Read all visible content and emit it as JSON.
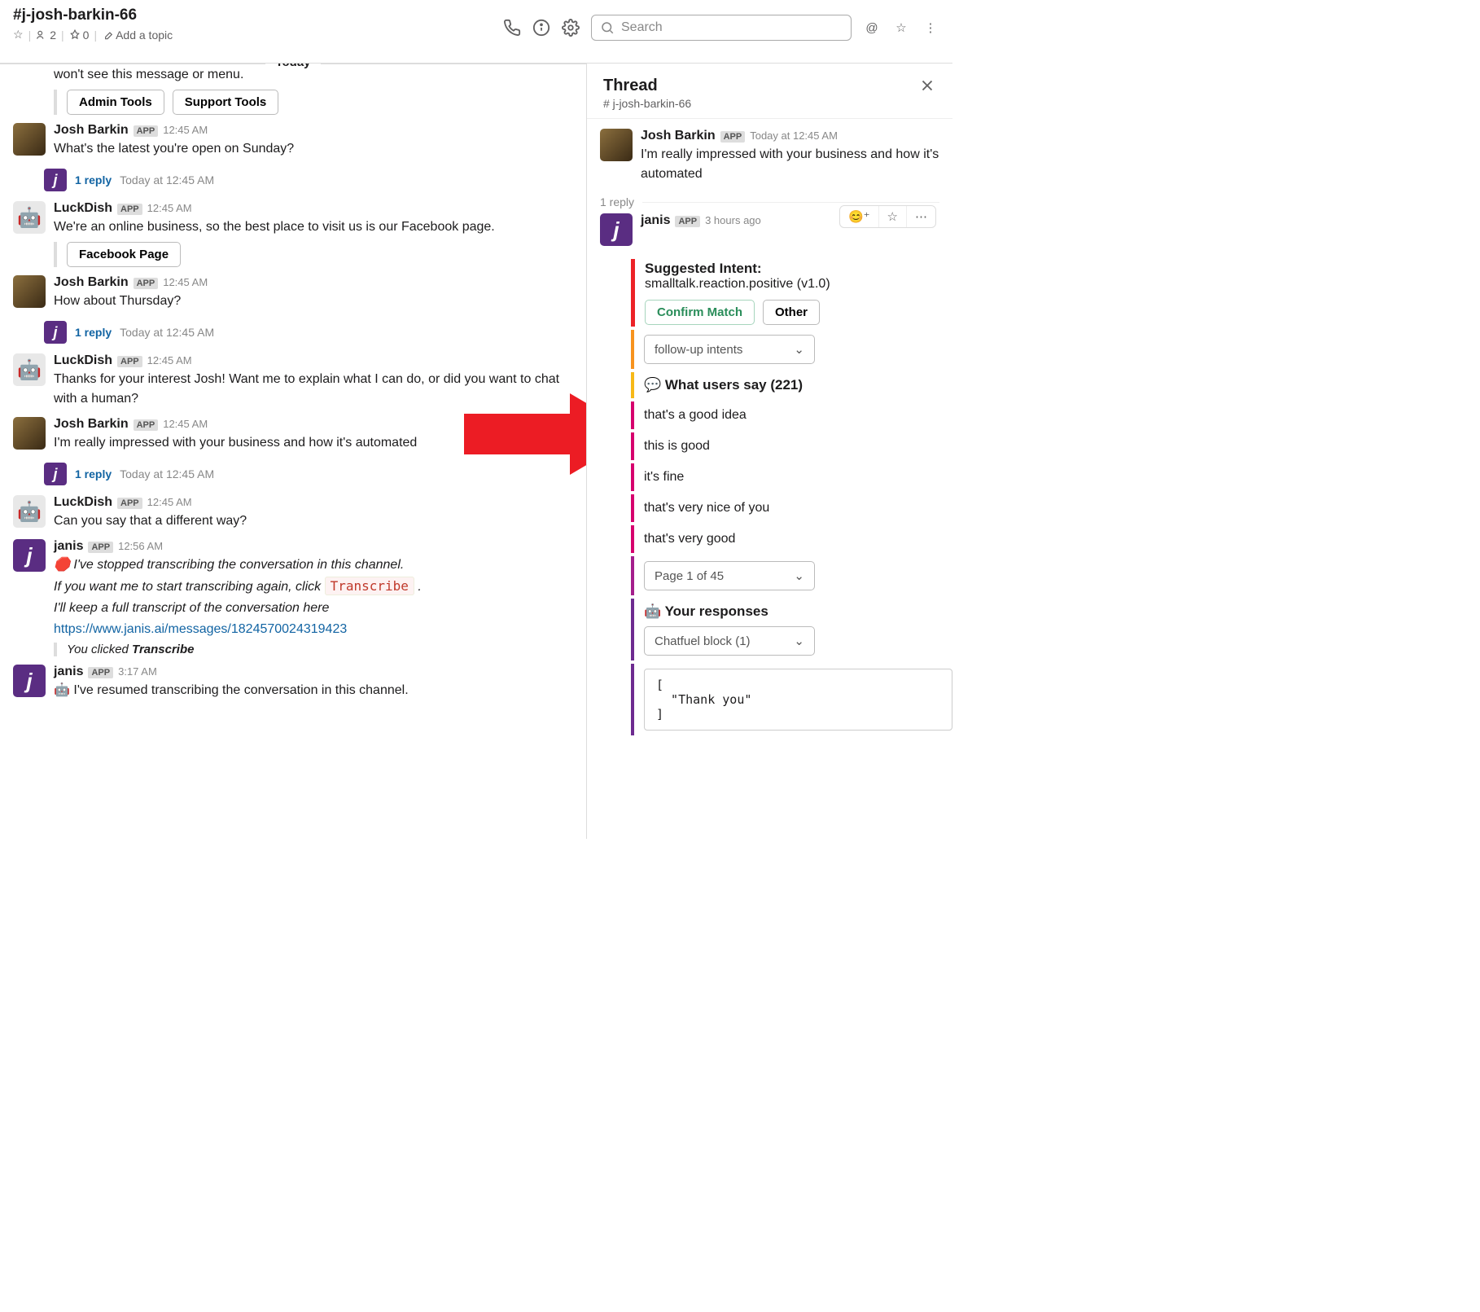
{
  "header": {
    "channel": "#j-josh-barkin-66",
    "members": "2",
    "pins": "0",
    "add_topic": "Add a topic",
    "search_placeholder": "Search"
  },
  "divider": "Today",
  "messages": [
    {
      "type": "continuation",
      "text": "won't see this message or menu.",
      "buttons": [
        "Admin Tools",
        "Support Tools"
      ]
    },
    {
      "user": "Josh Barkin",
      "badge": "APP",
      "time": "12:45 AM",
      "avatar": "josh",
      "text": "What's the latest you're open on Sunday?",
      "reply": {
        "count": "1 reply",
        "time": "Today at 12:45 AM"
      }
    },
    {
      "user": "LuckDish",
      "badge": "APP",
      "time": "12:45 AM",
      "avatar": "luckdish",
      "text": "We're an online business, so the best place to visit us is our Facebook page.",
      "buttons": [
        "Facebook Page"
      ]
    },
    {
      "user": "Josh Barkin",
      "badge": "APP",
      "time": "12:45 AM",
      "avatar": "josh",
      "text": "How about Thursday?",
      "reply": {
        "count": "1 reply",
        "time": "Today at 12:45 AM"
      }
    },
    {
      "user": "LuckDish",
      "badge": "APP",
      "time": "12:45 AM",
      "avatar": "luckdish",
      "text": "Thanks for your interest Josh! Want me to explain what I can do, or did you want to chat with a human?"
    },
    {
      "user": "Josh Barkin",
      "badge": "APP",
      "time": "12:45 AM",
      "avatar": "josh",
      "text": "I'm really impressed with your business and how it's automated",
      "reply": {
        "count": "1 reply",
        "time": "Today at 12:45 AM"
      }
    },
    {
      "user": "LuckDish",
      "badge": "APP",
      "time": "12:45 AM",
      "avatar": "luckdish",
      "text": "Can you say that a different way?"
    },
    {
      "user": "janis",
      "badge": "APP",
      "time": "12:56 AM",
      "avatar": "janis",
      "lines": [
        {
          "style": "normal",
          "pre": "🛑",
          "text": " I've stopped transcribing the conversation in this channel.",
          "italic": true
        },
        {
          "style": "italic",
          "text": "If you want me to start transcribing again, click ",
          "code": "Transcribe",
          "post": " ."
        },
        {
          "style": "italic",
          "text": "I'll keep a full transcript of the conversation here"
        },
        {
          "style": "link",
          "text": "https://www.janis.ai/messages/1824570024319423"
        }
      ],
      "quote": {
        "pre": "You clicked ",
        "bold": "Transcribe"
      }
    },
    {
      "user": "janis",
      "badge": "APP",
      "time": "3:17 AM",
      "avatar": "janis",
      "text": "🤖 I've resumed transcribing the conversation in this channel."
    }
  ],
  "thread": {
    "title": "Thread",
    "subtitle": "# j-josh-barkin-66",
    "parent": {
      "user": "Josh Barkin",
      "badge": "APP",
      "time": "Today at 12:45 AM",
      "text": "I'm really impressed with your business and how it's automated"
    },
    "reply_count": "1 reply",
    "reply": {
      "user": "janis",
      "badge": "APP",
      "time": "3 hours ago",
      "intent_label": "Suggested Intent:",
      "intent_value": "smalltalk.reaction.positive (v1.0)",
      "confirm": "Confirm Match",
      "other": "Other",
      "followup": "follow-up intents",
      "users_say": "💬 What users say (221)",
      "phrases": [
        "that's a good idea",
        "this is good",
        "it's fine",
        "that's very nice of you",
        "that's very good"
      ],
      "page": "Page 1 of 45",
      "responses_label": "🤖 Your responses",
      "chatfuel": "Chatfuel block (1)",
      "code": "[\n  \"Thank you\"\n]"
    }
  }
}
